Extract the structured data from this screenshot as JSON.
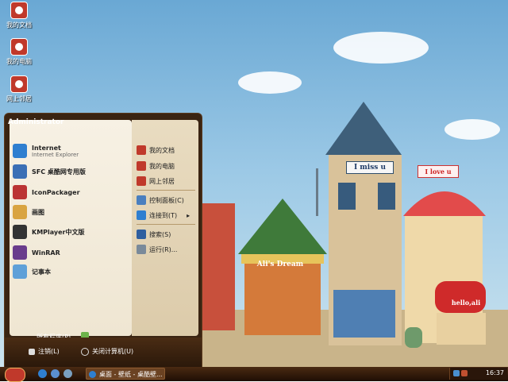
{
  "desktop_icons": [
    {
      "label": "我的文档",
      "icon": "my-documents-icon"
    },
    {
      "label": "我的电脑",
      "icon": "my-computer-icon"
    },
    {
      "label": "网上邻居",
      "icon": "network-places-icon"
    }
  ],
  "wallpaper": {
    "signs": [
      "I miss u",
      "I love u",
      "Ali's Dream",
      "hello,ali"
    ]
  },
  "start_menu": {
    "user": "Administrator",
    "pinned": [
      {
        "title": "Internet",
        "subtitle": "Internet Explorer",
        "icon": "internet-explorer-icon"
      },
      {
        "title": "SFC 桌酷网专用版",
        "icon": "sfc-icon"
      },
      {
        "title": "IconPackager",
        "icon": "iconpackager-icon"
      },
      {
        "title": "画图",
        "icon": "paint-icon"
      },
      {
        "title": "KMPlayer中文版",
        "icon": "kmplayer-icon"
      },
      {
        "title": "WinRAR",
        "icon": "winrar-icon"
      },
      {
        "title": "记事本",
        "icon": "notepad-icon"
      }
    ],
    "all_programs": "所有程序(P)",
    "right_items": [
      {
        "label": "我的文档",
        "icon": "my-documents-icon"
      },
      {
        "label": "我的电脑",
        "icon": "my-computer-icon"
      },
      {
        "label": "网上邻居",
        "icon": "network-places-icon"
      },
      {
        "label": "控制面板(C)",
        "icon": "control-panel-icon"
      },
      {
        "label": "连接到(T)",
        "icon": "connect-to-icon"
      },
      {
        "label": "搜索(S)",
        "icon": "search-icon"
      },
      {
        "label": "运行(R)...",
        "icon": "run-icon"
      }
    ],
    "logoff": "注销(L)",
    "shutdown": "关闭计算机(U)"
  },
  "taskbar": {
    "task_label": "桌面 - 壁纸 - 桌酷壁...",
    "clock": "16:37"
  },
  "colors": {
    "menu_frame": "#3a2412",
    "taskbar": "#2a160a",
    "accent_red": "#c0392b"
  }
}
